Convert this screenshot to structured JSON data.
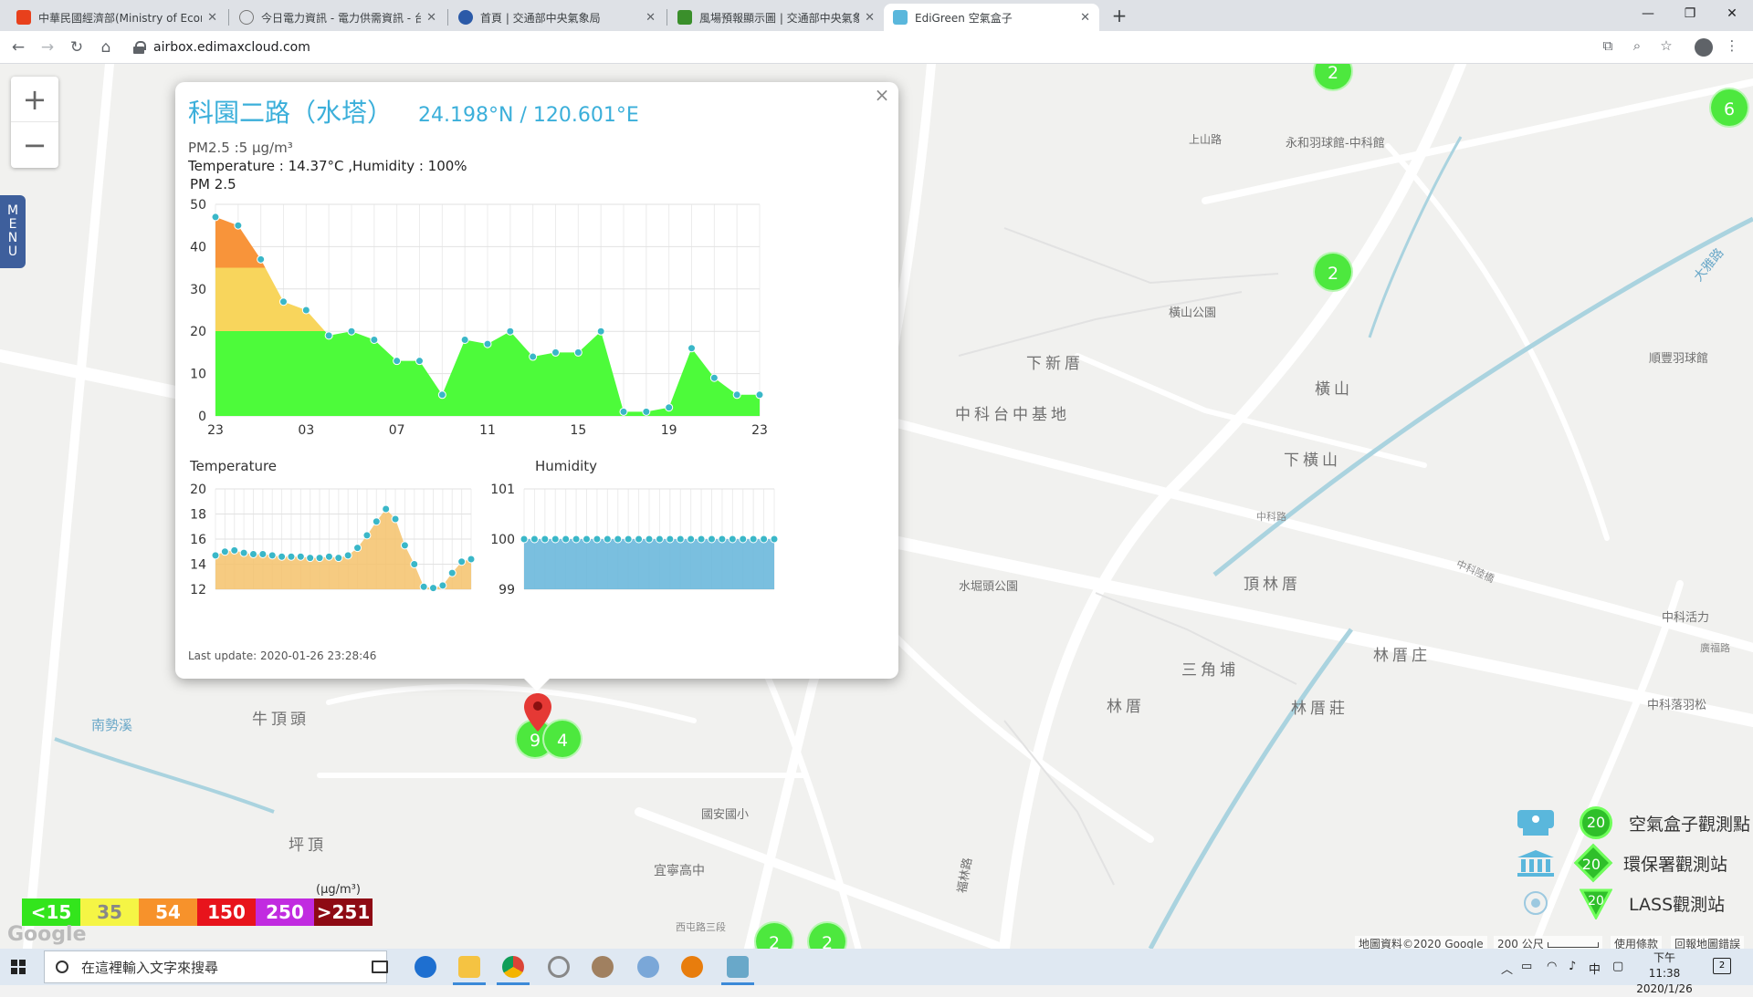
{
  "browser": {
    "tabs": [
      {
        "title": "中華民國經濟部(Ministry of Econ",
        "active": false
      },
      {
        "title": "今日電力資訊 - 電力供需資訊 - 台",
        "active": false
      },
      {
        "title": "首頁 | 交通部中央氣象局",
        "active": false
      },
      {
        "title": "風場預報顯示圖 | 交通部中央氣象",
        "active": false
      },
      {
        "title": "EdiGreen 空氣盒子",
        "active": true
      }
    ],
    "url": "airbox.edimaxcloud.com"
  },
  "map": {
    "menu_label": "MENU",
    "labels": [
      "科園二路",
      "上山路",
      "永和羽球館-中科館",
      "下新厝",
      "中科台中基地",
      "橫山",
      "下橫山",
      "橫山公園",
      "順豐羽球館",
      "中科路",
      "頂林厝",
      "水堀頭公園",
      "三角埔",
      "林厝庄",
      "林厝",
      "林厝莊",
      "牛頂頭",
      "坪頂",
      "國安國小",
      "宜寧高中",
      "西屯路三段",
      "南勢溪",
      "大雅路",
      "中科落羽松",
      "中科活力",
      "中科陸橋",
      "廣福路",
      "福林路"
    ],
    "clusters": [
      "2",
      "6",
      "2",
      "9",
      "4",
      "2",
      "2"
    ]
  },
  "popup": {
    "name": "科園二路（水塔）",
    "coords": "24.198°N / 120.601°E",
    "pm25_line": "PM2.5 :5 μg/m³",
    "temp_hum_line": "Temperature : 14.37°C ,Humidity : 100%",
    "chart_title": "PM 2.5",
    "temp_title": "Temperature",
    "hum_title": "Humidity",
    "last_update": "Last update: 2020-01-26 23:28:46",
    "close": "×"
  },
  "chart_data": [
    {
      "type": "area",
      "title": "PM 2.5",
      "x_tick_labels": [
        "23",
        "03",
        "07",
        "11",
        "15",
        "19",
        "23"
      ],
      "ylim": [
        0,
        50
      ],
      "y_ticks": [
        0,
        10,
        20,
        30,
        40,
        50
      ],
      "series": [
        {
          "values": [
            47,
            45,
            37,
            27,
            25,
            19,
            20,
            18,
            13,
            13,
            5,
            18,
            17,
            20,
            14,
            15,
            15,
            20,
            1,
            1,
            2,
            16,
            9,
            5,
            5
          ]
        }
      ],
      "bands": [
        {
          "from": 0,
          "to": 20,
          "color": "#4dfb3a"
        },
        {
          "from": 20,
          "to": 35,
          "color": "#f8d55c"
        },
        {
          "from": 35,
          "to": 50,
          "color": "#f8943a"
        }
      ],
      "grid": true
    },
    {
      "type": "area",
      "title": "Temperature",
      "ylim": [
        12,
        20
      ],
      "y_ticks": [
        12,
        14,
        16,
        18,
        20
      ],
      "series": [
        {
          "values": [
            14.7,
            15,
            15.1,
            14.9,
            14.8,
            14.8,
            14.7,
            14.6,
            14.6,
            14.6,
            14.5,
            14.5,
            14.6,
            14.5,
            14.7,
            15.3,
            16.3,
            17.4,
            18.4,
            17.6,
            15.5,
            14,
            12.2,
            12.1,
            12.3,
            13.3,
            14.2,
            14.4
          ],
          "color": "#f5c26b"
        }
      ],
      "grid": true
    },
    {
      "type": "area",
      "title": "Humidity",
      "ylim": [
        99,
        101
      ],
      "y_ticks": [
        99,
        100,
        101
      ],
      "series": [
        {
          "values": [
            100,
            100,
            100,
            100,
            100,
            100,
            100,
            100,
            100,
            100,
            100,
            100,
            100,
            100,
            100,
            100,
            100,
            100,
            100,
            100,
            100,
            100,
            100,
            100,
            100
          ],
          "color": "#6cb8dc"
        }
      ],
      "grid": true
    }
  ],
  "legend": {
    "unit": "(μg/m³)",
    "items": [
      {
        "label": "<15",
        "color": "#33e51c"
      },
      {
        "label": "35",
        "color": "#f5f545"
      },
      {
        "label": "54",
        "color": "#f7922b"
      },
      {
        "label": "150",
        "color": "#e8141c"
      },
      {
        "label": "250",
        "color": "#c12be0"
      },
      {
        "label": ">251",
        "color": "#8e0a14"
      }
    ]
  },
  "stations": [
    {
      "label": "空氣盒子觀測點",
      "count": "20"
    },
    {
      "label": "環保署觀測站",
      "count": "20"
    },
    {
      "label": "LASS觀測站",
      "count": "20"
    }
  ],
  "attribution": {
    "data": "地圖資料©2020 Google",
    "scale": "200 公尺",
    "terms": "使用條款",
    "report": "回報地圖錯誤"
  },
  "watermark": "Google",
  "taskbar": {
    "search_placeholder": "在這裡輸入文字來搜尋",
    "ime": "中",
    "time": "下午 11:38",
    "date": "2020/1/26",
    "notifications": "2"
  }
}
